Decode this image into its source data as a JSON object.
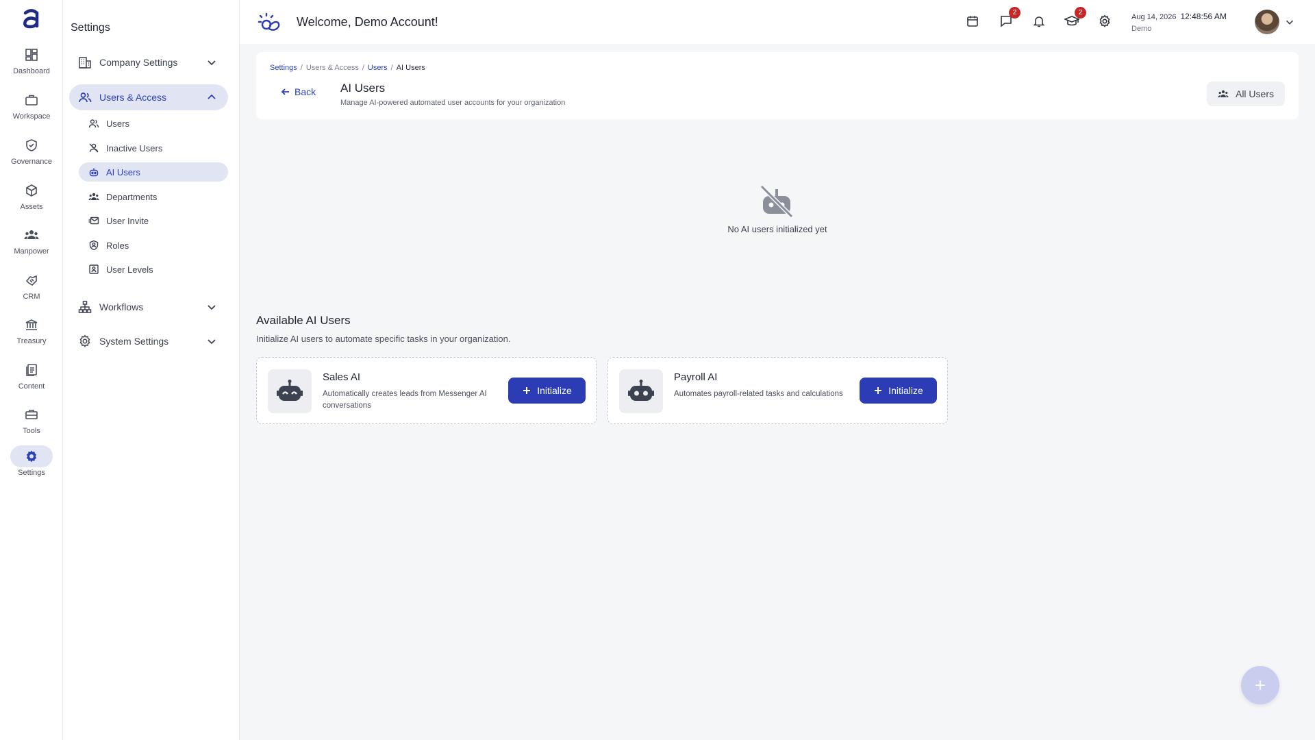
{
  "colors": {
    "accent": "#2b3cb5",
    "accent_soft": "#e1e4f3",
    "badge": "#c62828",
    "background": "#f5f6f8"
  },
  "rail": {
    "items": [
      {
        "label": "Dashboard",
        "icon": "dashboard-icon"
      },
      {
        "label": "Workspace",
        "icon": "briefcase-icon"
      },
      {
        "label": "Governance",
        "icon": "shield-check-icon"
      },
      {
        "label": "Assets",
        "icon": "cube-icon"
      },
      {
        "label": "Manpower",
        "icon": "people-icon"
      },
      {
        "label": "CRM",
        "icon": "handshake-icon"
      },
      {
        "label": "Treasury",
        "icon": "bank-icon"
      },
      {
        "label": "Content",
        "icon": "document-icon"
      },
      {
        "label": "Tools",
        "icon": "toolbox-icon"
      },
      {
        "label": "Settings",
        "icon": "gear-icon",
        "active": true
      }
    ]
  },
  "settings_panel": {
    "title": "Settings",
    "groups": [
      {
        "label": "Company Settings",
        "icon": "building-icon",
        "expanded": false
      },
      {
        "label": "Users & Access",
        "icon": "users-icon",
        "expanded": true
      },
      {
        "label": "Workflows",
        "icon": "sitemap-icon",
        "expanded": false
      },
      {
        "label": "System Settings",
        "icon": "gear-icon",
        "expanded": false
      }
    ],
    "users_access_items": [
      {
        "label": "Users",
        "icon": "users-icon"
      },
      {
        "label": "Inactive Users",
        "icon": "user-off-icon"
      },
      {
        "label": "AI Users",
        "icon": "robot-icon",
        "active": true
      },
      {
        "label": "Departments",
        "icon": "group-icon"
      },
      {
        "label": "User Invite",
        "icon": "mail-invite-icon"
      },
      {
        "label": "Roles",
        "icon": "role-badge-icon"
      },
      {
        "label": "User Levels",
        "icon": "id-card-icon"
      }
    ]
  },
  "header": {
    "title": "Welcome, Demo Account!",
    "messages_badge": "2",
    "learning_badge": "2",
    "date": "Aug 14, 2026",
    "time": "12:48:56 AM",
    "user": "Demo"
  },
  "page": {
    "breadcrumbs": [
      "Settings",
      "Users & Access",
      "Users",
      "AI Users"
    ],
    "back_label": "Back",
    "title": "AI Users",
    "subtitle": "Manage AI-powered automated user accounts for your organization",
    "all_users_label": "All Users"
  },
  "empty_state": {
    "text": "No AI users initialized yet"
  },
  "available": {
    "title": "Available AI Users",
    "subtitle": "Initialize AI users to automate specific tasks in your organization.",
    "cards": [
      {
        "name": "Sales AI",
        "description": "Automatically creates leads from Messenger AI conversations",
        "button": "Initialize"
      },
      {
        "name": "Payroll AI",
        "description": "Automates payroll-related tasks and calculations",
        "button": "Initialize"
      }
    ]
  }
}
